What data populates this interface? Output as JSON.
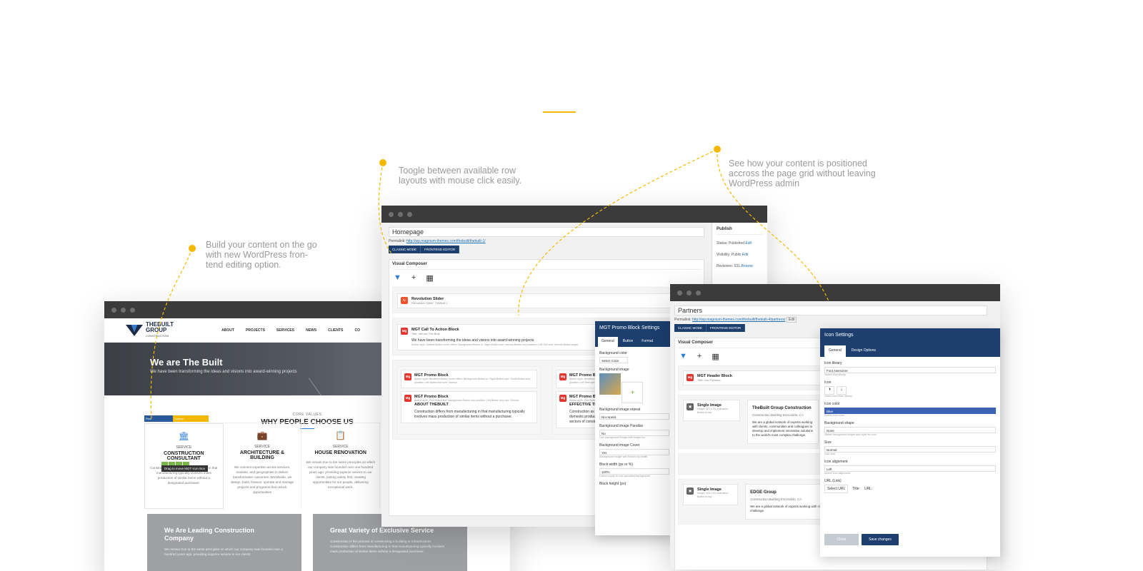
{
  "callouts": {
    "left": "Build your content on the go\nwith new WordPress fron-\ntend editing option.",
    "middle": "Toogle between available row\nlayouts with mouse click easily.",
    "right": "See how your content is positioned\naccross the page grid without leaving\nWordPress admin"
  },
  "frontend_window": {
    "logo": {
      "name": "THEBUILT",
      "sub": "GROUP",
      "tag": "CONSTRUCTION"
    },
    "nav": [
      "ABOUT",
      "PROJECTS",
      "SERVICES",
      "NEWS",
      "CLIENTS",
      "CO"
    ],
    "hero": {
      "title": "We are The Built",
      "subtitle": "We have been transforming the ideas and visions into award-winning projects"
    },
    "section": {
      "eyebrow": "CORE VALUES",
      "title": "WHY PEOPLE CHOOSE US"
    },
    "row_controls": {
      "row": "Row",
      "column": "Column"
    },
    "drag_tip": "Drag to move MGT Icon Box",
    "services": [
      {
        "icon": "bank-icon",
        "label": "SERVICE",
        "title": "CONSTRUCTION CONSULTANT",
        "text": "Construction differs from manufacturing in that manufacturing typically involves mass production of similar items without a designated purchaser."
      },
      {
        "icon": "briefcase-icon",
        "label": "SERVICE",
        "title": "ARCHITECTURE & BUILDING",
        "text": "We connect expertise across services, markets, and geographies to deliver transformative outcomes. Worldwide, we design, build, finance, operate and manage projects and programs that unlock opportunities"
      },
      {
        "icon": "clipboard-icon",
        "label": "SERVICE",
        "title": "HOUSE RENOVATION",
        "text": "We remain true to the same principles on which our company was founded over one hundred years ago: providing superior service to our clients, putting safety first, creating opportunities for our people, delivering exceptional work."
      }
    ],
    "cards": [
      {
        "title": "We Are Leading Construction Company",
        "text": "We remain true to the same principles on which our company was founded over a hundred years ago: providing superior service to our clients"
      },
      {
        "title": "Great Variety of Exclusive Service",
        "text": "Construction is the process of constructing a building or infrastructure. Construction differs from manufacturing in that manufacturing typically involves mass production of similar items without a designated purchaser."
      }
    ]
  },
  "classic_window": {
    "title": "Homepage",
    "permalink_label": "Permalink:",
    "permalink_url": "http://wp.magnium-themes.com/thebuilt/thebuilt-1/",
    "modes": [
      "CLASSIC MODE",
      "FRONTEND EDITOR"
    ],
    "vc_title": "Visual Composer",
    "elements": [
      {
        "name": "Revolution Slider",
        "sub": "Revolution Slider: TheBuilt 1"
      },
      {
        "name": "MGT Call To Action Block",
        "sub": "Title: We are The Built",
        "body": "We have been transforming the ideas and visions into award-winning projects",
        "fine": "Button style: Default  Button hover effect: Background Button to: Right  Button size: Normal  Button icon position: Left  Text size: Normal  Button target"
      }
    ],
    "promos_left": [
      {
        "name": "MGT Promo Block",
        "fine": "Button style: Bordered  Button hover effect: Background Button to: Right  Button size: Small  Button icon position: Left  Button text size: Normal"
      },
      {
        "name": "MGT Promo Block",
        "fine": "Button style: Text  Button link: Background  Button icon position: Left  Button text size: Normal",
        "heading": "ABOUT THEBUILT",
        "body": "Construction differs from manufacturing in that manufacturing typically involves mass production of similar items without a purchaser."
      }
    ],
    "promos_right": [
      {
        "name": "MGT Promo Block",
        "fine": "Button style: Bordered  Button hover effect: Background Button to: Right  Button size: Normal  Button icon position: Left  Text size: Normal"
      },
      {
        "name": "MGT Promo Block",
        "fine": "Button style: Text  Button link: Background  Button icon position: Left  Button text size: Normal",
        "heading": "EFFECTIVE TEAMWORK",
        "body": "Construction as an industry comprises six to nine percent of the gross domestic product of developed countries. In general, there are three sectors of construction."
      }
    ],
    "publish": {
      "title": "Publish",
      "status": "Status: Published",
      "visibility": "Visibility: Public",
      "revisions": "Revisions: 531",
      "edit": "Edit",
      "browse": "Browse"
    }
  },
  "promo_panel": {
    "title": "MGT Promo Block Settings",
    "tabs": [
      "General",
      "Button",
      "Format"
    ],
    "fields": [
      {
        "label": "Background color",
        "value": "Select Color"
      },
      {
        "label": "Background image",
        "value": ""
      },
      {
        "label": "Background image repeat",
        "value": "No-repeat"
      },
      {
        "label": "Background image Parallax",
        "value": "No",
        "hint": "Use background image with height for..."
      },
      {
        "label": "Background image Cover",
        "value": "Yes",
        "hint": "Background image will fit block by width"
      },
      {
        "label": "Block width (px or %)",
        "value": "100%",
        "hint": "Leave empty to use uploaded background"
      },
      {
        "label": "Block height (px)",
        "value": ""
      }
    ]
  },
  "partners_window": {
    "title": "Partners",
    "permalink_label": "Permalink:",
    "permalink_url": "http://wp.magnium-themes.com/thebuilt/thebuilt-4/partners/",
    "edit": "Edit",
    "modes": [
      "CLASSIC MODE",
      "FRONTEND EDITOR"
    ],
    "vc_title": "Visual Composer",
    "header_block": {
      "name": "MGT Header Block",
      "sub": "Title: Our Partners"
    },
    "rows": [
      {
        "image_name": "Single Image",
        "image_fine": "Image: 921  CSS Animation: Button to top",
        "company": "TheBuilt Group Construction",
        "addr": "Construction Building Escondido, CA",
        "body": "We are a global network of experts working with clients, communities and colleagues to develop and implement innovative solutions to the world's most complex challenge."
      },
      {
        "image_name": "Single Image",
        "image_fine": "Image: 925  CSS Animation: Button to top",
        "company": "EDGE Group",
        "addr": "Construction Building Escondido, CA",
        "body": "We are a global network of experts working with clients, communities and colleagues to develop and implement innovative solutions to the world's most complex challenge."
      }
    ]
  },
  "icon_panel": {
    "title": "Icon Settings",
    "tabs": [
      "General",
      "Design Options"
    ],
    "fields": [
      {
        "label": "Icon library",
        "value": "Font Awesome",
        "hint": "Select icon library."
      },
      {
        "label": "Icon",
        "value": "",
        "hint": "Select icon from library."
      },
      {
        "label": "Icon color",
        "value": "Blue",
        "hint": "Select icon color."
      },
      {
        "label": "Background shape",
        "value": "None",
        "hint": "Select background shape and style for icon."
      },
      {
        "label": "Size",
        "value": "Normal",
        "hint": "Icon size."
      },
      {
        "label": "Icon alignment",
        "value": "Left",
        "hint": "Select icon alignment."
      }
    ],
    "url_label": "URL (Link)",
    "select_url": "Select URL",
    "url_title": "Title:",
    "url_url": "URL:",
    "close": "Close",
    "save": "Save changes"
  },
  "colors": {
    "accent": "#f5b800",
    "navy": "#1c3f6e",
    "brand_red": "#e5352d"
  }
}
